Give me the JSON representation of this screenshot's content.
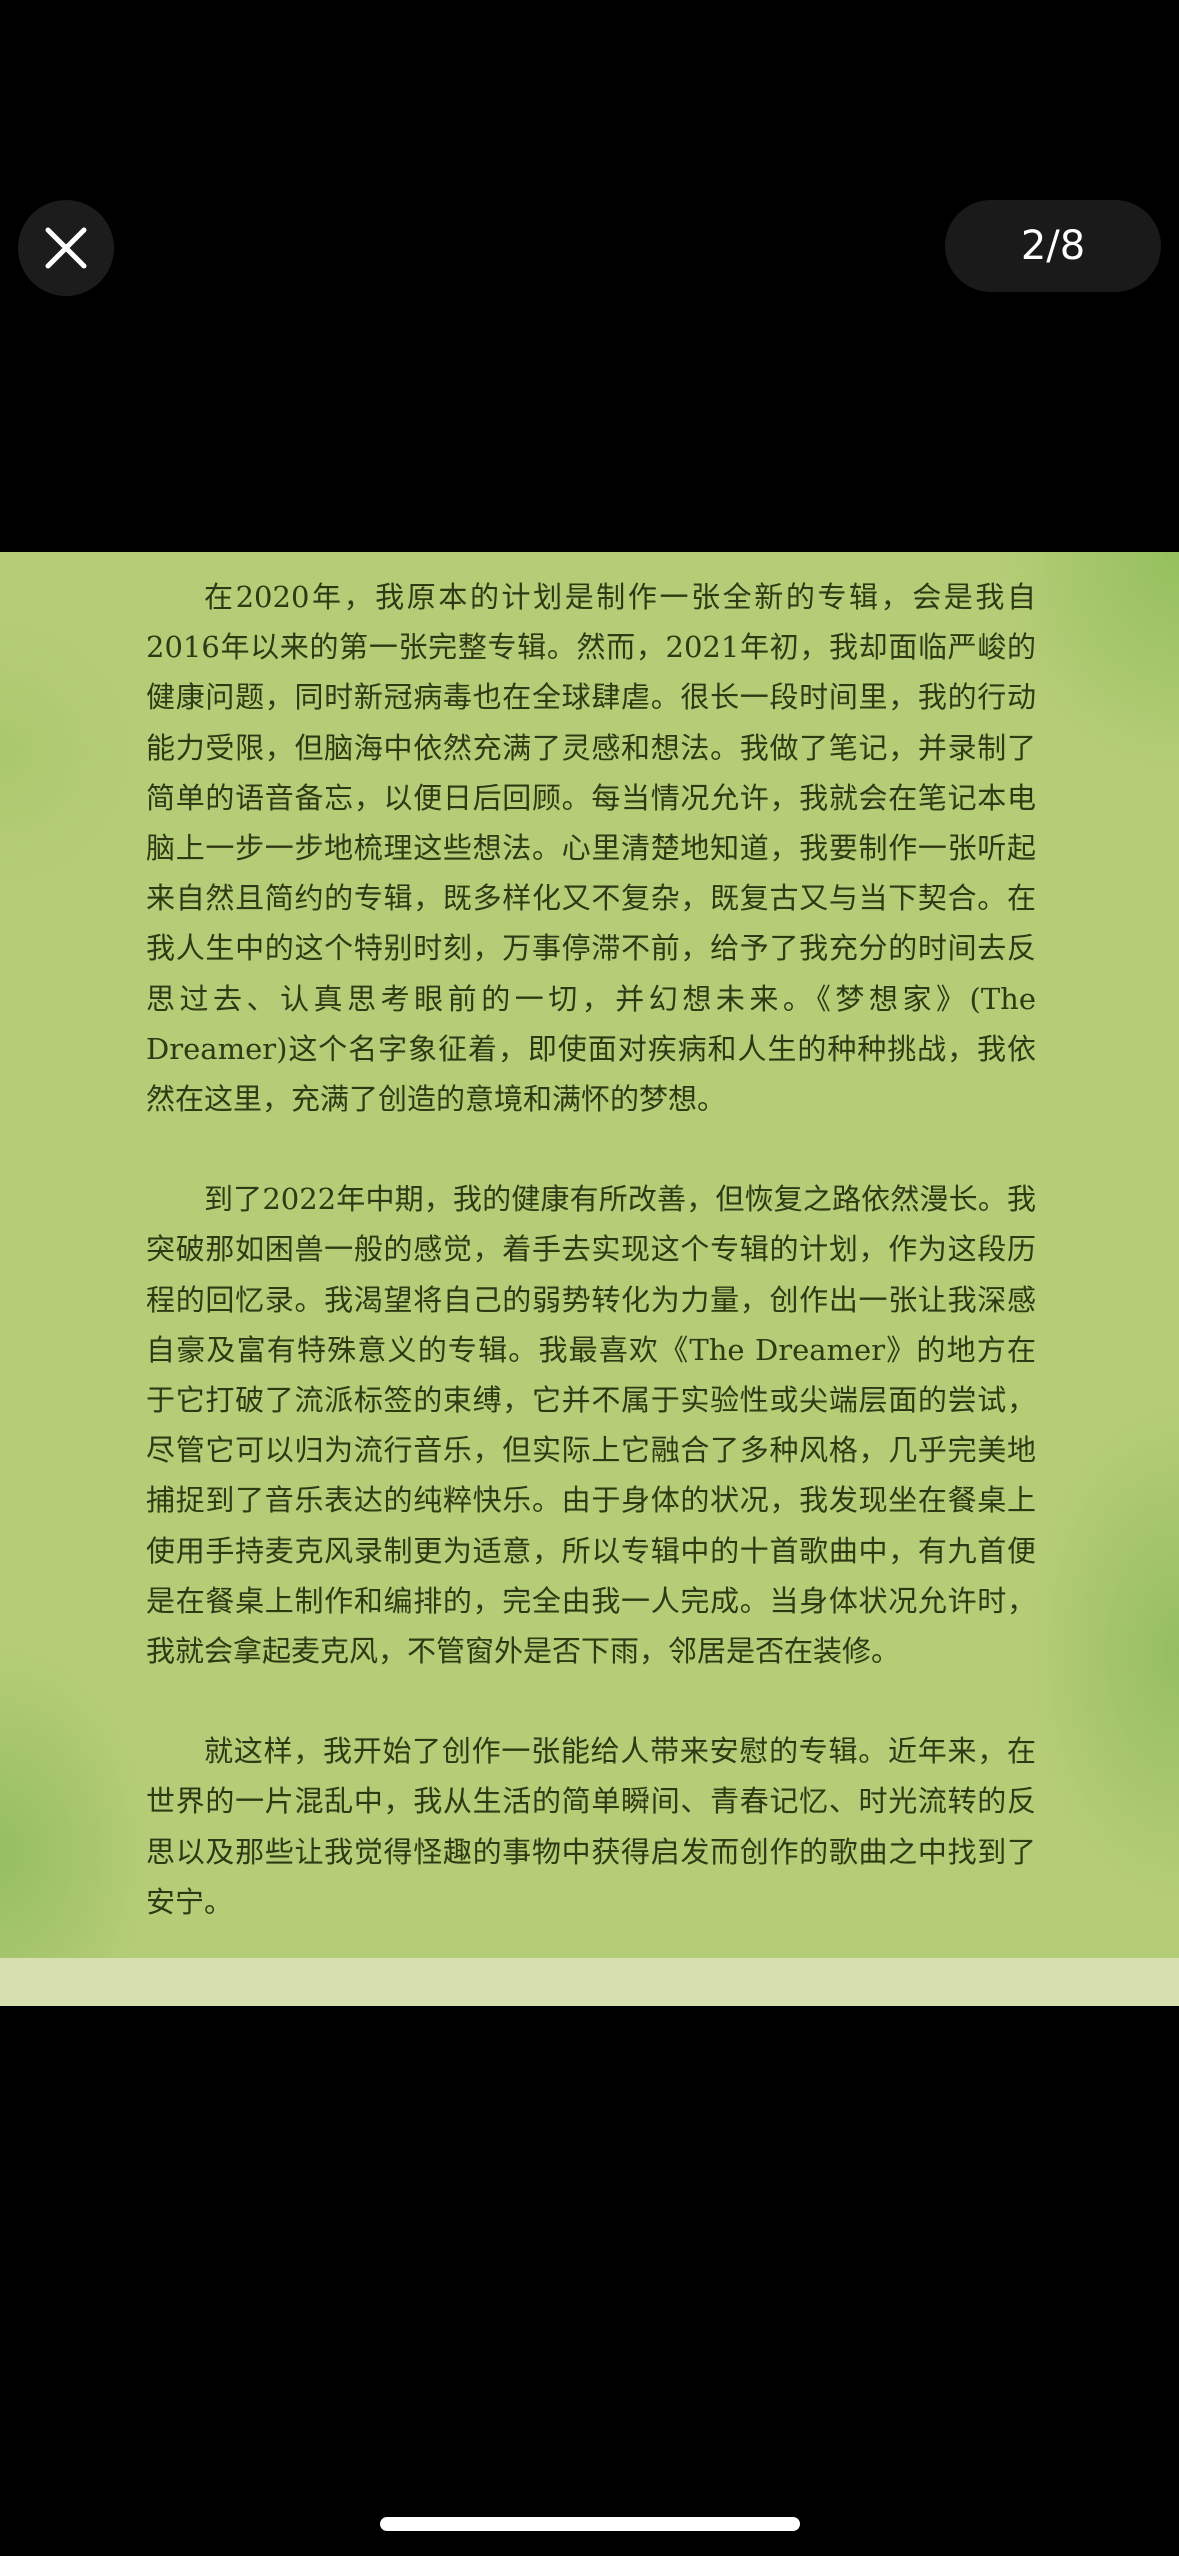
{
  "viewer": {
    "page_counter": "2/8",
    "close_icon": "close-icon"
  },
  "article": {
    "paragraphs": [
      "在2020年，我原本的计划是制作一张全新的专辑，会是我自2016年以来的第一张完整专辑。然而，2021年初，我却面临严峻的健康问题，同时新冠病毒也在全球肆虐。很长一段时间里，我的行动能力受限，但脑海中依然充满了灵感和想法。我做了笔记，并录制了简单的语音备忘，以便日后回顾。每当情况允许，我就会在笔记本电脑上一步一步地梳理这些想法。心里清楚地知道，我要制作一张听起来自然且简约的专辑，既多样化又不复杂，既复古又与当下契合。在我人生中的这个特别时刻，万事停滞不前，给予了我充分的时间去反思过去、认真思考眼前的一切，并幻想未来。《梦想家》(The Dreamer)这个名字象征着，即使面对疾病和人生的种种挑战，我依然在这里，充满了创造的意境和满怀的梦想。",
      "到了2022年中期，我的健康有所改善，但恢复之路依然漫长。我突破那如困兽一般的感觉，着手去实现这个专辑的计划，作为这段历程的回忆录。我渴望将自己的弱势转化为力量，创作出一张让我深感自豪及富有特殊意义的专辑。我最喜欢《The Dreamer》的地方在于它打破了流派标签的束缚，它并不属于实验性或尖端层面的尝试，尽管它可以归为流行音乐，但实际上它融合了多种风格，几乎完美地捕捉到了音乐表达的纯粹快乐。由于身体的状况，我发现坐在餐桌上使用手持麦克风录制更为适意，所以专辑中的十首歌曲中，有九首便是在餐桌上制作和编排的，完全由我一人完成。当身体状况允许时，我就会拿起麦克风，不管窗外是否下雨，邻居是否在装修。",
      "就这样，我开始了创作一张能给人带来安慰的专辑。近年来，在世界的一片混乱中，我从生活的简单瞬间、青春记忆、时光流转的反思以及那些让我觉得怪趣的事物中获得启发而创作的歌曲之中找到了安宁。"
    ]
  },
  "colors": {
    "background": "#000000",
    "paper": "#b6cd78",
    "text": "#2f3a14"
  }
}
